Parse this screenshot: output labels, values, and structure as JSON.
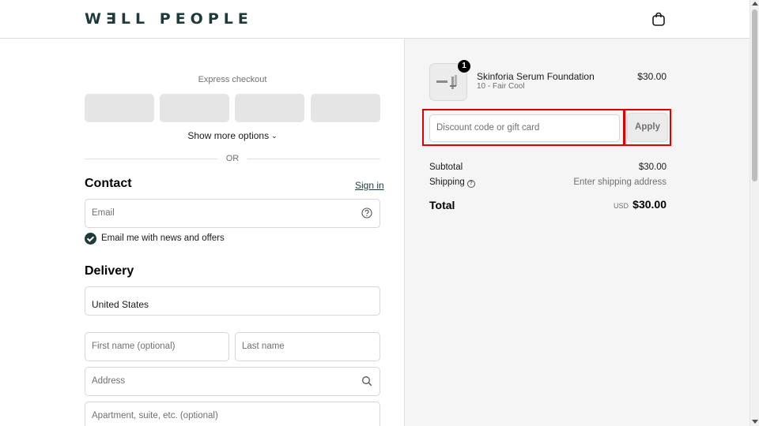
{
  "header": {
    "logo": "W∃LL PEOPLE",
    "cart_icon": "shopping-bag-icon"
  },
  "express": {
    "title": "Express checkout",
    "show_more": "Show more options",
    "or": "OR"
  },
  "contact": {
    "title": "Contact",
    "sign_in": "Sign in",
    "email_placeholder": "Email",
    "newsletter_label": "Email me with news and offers",
    "newsletter_checked": true
  },
  "delivery": {
    "title": "Delivery",
    "country": "United States",
    "first_name_placeholder": "First name (optional)",
    "last_name_placeholder": "Last name",
    "address_placeholder": "Address",
    "apartment_placeholder": "Apartment, suite, etc. (optional)"
  },
  "order": {
    "item": {
      "name": "Skinforia Serum Foundation",
      "variant": "10 - Fair Cool",
      "price": "$30.00",
      "quantity": "1"
    },
    "discount_placeholder": "Discount code or gift card",
    "apply_label": "Apply",
    "subtotal_label": "Subtotal",
    "subtotal_value": "$30.00",
    "shipping_label": "Shipping",
    "shipping_value": "Enter shipping address",
    "total_label": "Total",
    "total_currency": "USD",
    "total_value": "$30.00"
  },
  "colors": {
    "brand": "#1f3a3a",
    "highlight": "#e10000",
    "sidebar_bg": "#f5f5f5"
  }
}
